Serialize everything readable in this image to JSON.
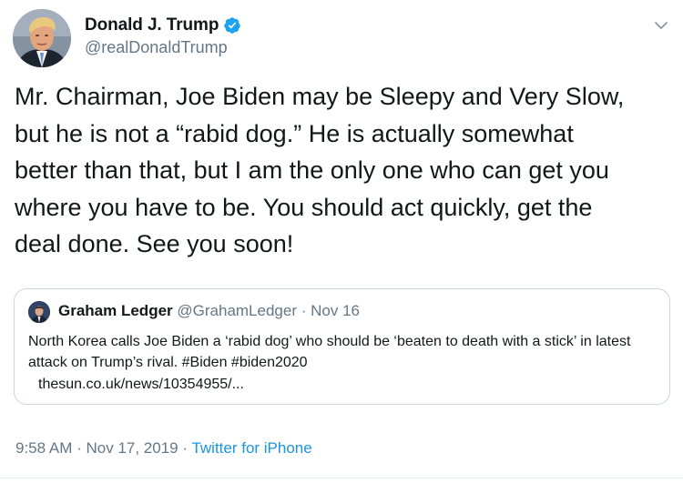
{
  "author": {
    "display_name": "Donald J. Trump",
    "handle": "@realDonaldTrump",
    "verified_icon": "verified-badge-icon"
  },
  "tweet": {
    "text": "Mr. Chairman, Joe Biden may be Sleepy and Very Slow,\nbut he is not a “rabid dog.” He is actually somewhat\nbetter than that, but I am the only one who can get you\nwhere you have to be. You should act quickly, get the\ndeal done. See you soon!"
  },
  "quote": {
    "name": "Graham Ledger",
    "handle": "@GrahamLedger",
    "separator": "·",
    "date": "Nov 16",
    "text": "North Korea calls Joe Biden a ‘rabid dog’ who should be ‘beaten to death with a stick’ in latest attack on Trump’s rival. #Biden #biden2020",
    "link": "thesun.co.uk/news/10354955/..."
  },
  "meta": {
    "time": "9:58 AM",
    "separator": " · ",
    "date": "Nov 17, 2019",
    "separator2": " · ",
    "source": "Twitter for iPhone"
  },
  "colors": {
    "text": "#14171a",
    "secondary": "#657786",
    "link": "#1b95e0",
    "border": "#ccd6dd",
    "verified": "#1da1f2"
  },
  "icons": {
    "more": "chevron-down-icon",
    "verified": "verified-badge-icon"
  }
}
